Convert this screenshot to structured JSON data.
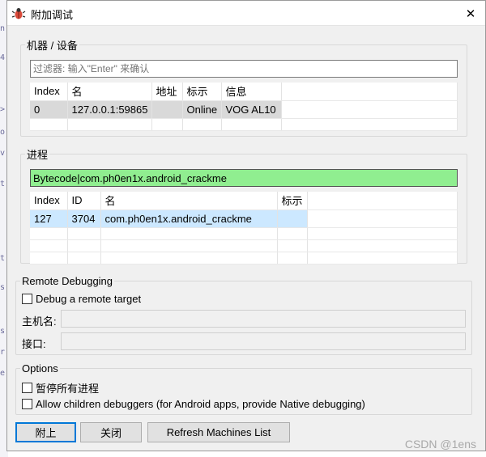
{
  "window": {
    "title": "附加调试",
    "icon": "bug-icon",
    "close_glyph": "✕"
  },
  "machines": {
    "group_title": "机器 / 设备",
    "filter_placeholder": "过滤器: 输入\"Enter\" 来确认",
    "columns": [
      "Index",
      "名",
      "地址",
      "标示",
      "信息"
    ],
    "rows": [
      [
        "0",
        "127.0.0.1:59865",
        "",
        "Online",
        "VOG AL10"
      ]
    ]
  },
  "process": {
    "group_title": "进程",
    "filter_value": "Bytecode|com.ph0en1x.android_crackme",
    "columns": [
      "Index",
      "ID",
      "名",
      "标示"
    ],
    "rows": [
      [
        "127",
        "3704",
        "com.ph0en1x.android_crackme",
        ""
      ]
    ]
  },
  "remote": {
    "group_title": "Remote Debugging",
    "checkbox_label": "Debug a remote target",
    "checked": false,
    "host_label": "主机名:",
    "host_value": "",
    "port_label": "接口:",
    "port_value": ""
  },
  "options": {
    "group_title": "Options",
    "pause_all_label": "暂停所有进程",
    "pause_all_checked": false,
    "allow_children_label": "Allow children debuggers (for Android apps, provide Native debugging)",
    "allow_children_checked": false
  },
  "buttons": {
    "attach": "附上",
    "close": "关闭",
    "refresh": "Refresh Machines List"
  },
  "watermark": "CSDN @1ens"
}
